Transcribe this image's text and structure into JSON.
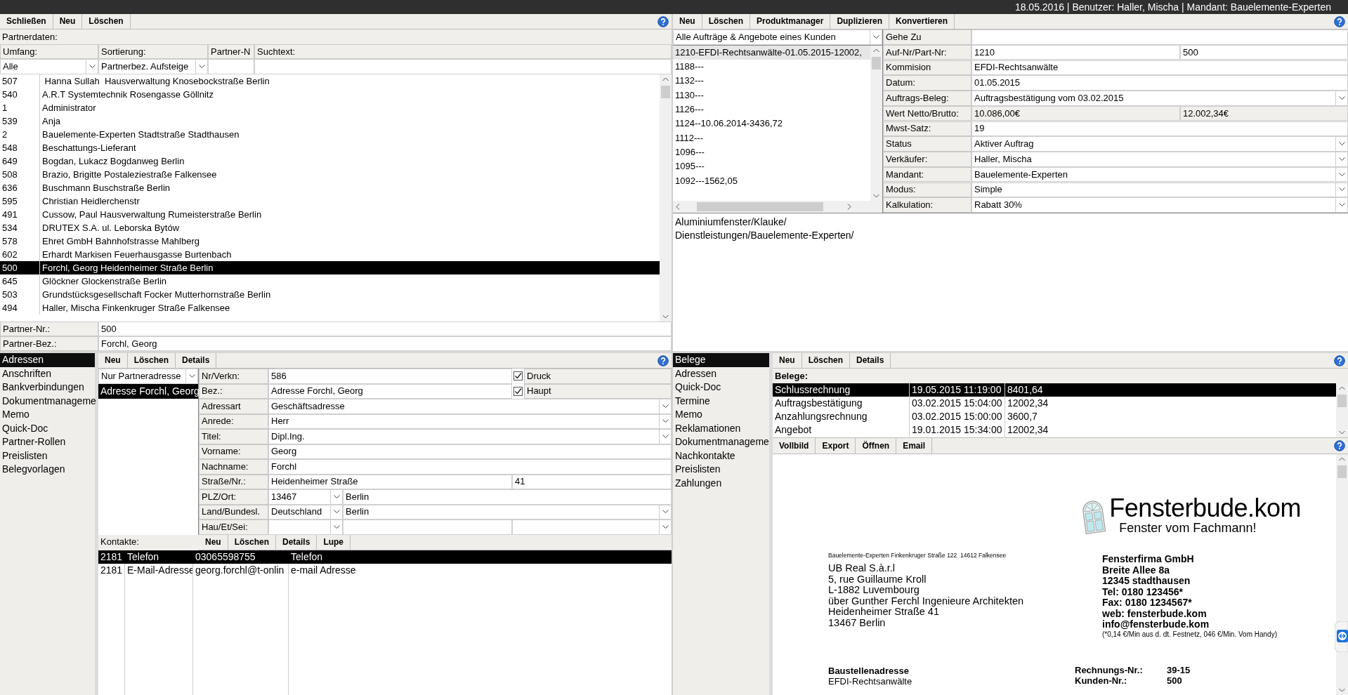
{
  "header": {
    "status": "18.05.2016 | Benutzer: Haller, Mischa | Mandant: Bauelemente-Experten"
  },
  "partners": {
    "toolbar": [
      "Schließen",
      "Neu",
      "Löschen"
    ],
    "title": "Partnerdaten:",
    "filters": [
      {
        "label": "Umfang:",
        "kind": "combo",
        "value": "Alle"
      },
      {
        "label": "Sortierung:",
        "kind": "combo",
        "value": "Partnerbez. Aufsteige"
      },
      {
        "label": "Partner-N",
        "kind": "text"
      },
      {
        "label": "Suchtext:",
        "kind": "text"
      }
    ],
    "rows": [
      {
        "id": "507",
        "name": " Hanna Sullah  Hausverwaltung Knosebockstraße Berlin",
        "selected": false
      },
      {
        "id": "540",
        "name": "A.R.T Systemtechnik Rosengasse Göllnitz",
        "selected": false
      },
      {
        "id": "1",
        "name": "Administrator",
        "selected": false
      },
      {
        "id": "539",
        "name": "Anja",
        "selected": false
      },
      {
        "id": "2",
        "name": "Bauelemente-Experten Stadtstraße Stadthausen",
        "selected": false
      },
      {
        "id": "548",
        "name": "Beschattungs-Lieferant",
        "selected": false
      },
      {
        "id": "649",
        "name": "Bogdan, Lukacz Bogdanweg Berlin",
        "selected": false
      },
      {
        "id": "508",
        "name": "Brazio, Brigitte Postaleziestraße Falkensee",
        "selected": false
      },
      {
        "id": "636",
        "name": "Buschmann Buschstraße Berlin",
        "selected": false
      },
      {
        "id": "595",
        "name": "Christian Heidlerchenstr",
        "selected": false
      },
      {
        "id": "491",
        "name": "Cussow, Paul Hausverwaltung Rumeisterstraße Berlin",
        "selected": false
      },
      {
        "id": "534",
        "name": "DRUTEX S.A. ul. Leborska Bytów",
        "selected": false
      },
      {
        "id": "578",
        "name": "Ehret GmbH Bahnhofstrasse Mahlberg",
        "selected": false
      },
      {
        "id": "602",
        "name": "Erhardt Markisen Feuerhausgasse Burtenbach",
        "selected": false
      },
      {
        "id": "500",
        "name": "Forchl, Georg Heidenheimer Straße Berlin",
        "selected": true
      },
      {
        "id": "645",
        "name": "Glöckner Glockenstraße Berlin",
        "selected": false
      },
      {
        "id": "503",
        "name": "Grundstücksgesellschaft Focker Mutterhornstraße Berlin",
        "selected": false
      },
      {
        "id": "494",
        "name": "Haller, Mischa Finkenkruger Straße Falkensee",
        "selected": false
      }
    ],
    "fields": [
      {
        "label": "Partner-Nr.:",
        "value": "500"
      },
      {
        "label": "Partner-Bez.:",
        "value": "Forchl, Georg"
      }
    ]
  },
  "orders": {
    "toolbar": [
      "Neu",
      "Löschen",
      "Produktmanager",
      "Duplizieren",
      "Konvertieren"
    ],
    "filter": "Alle Aufträge & Angebote eines Kunden",
    "list": [
      {
        "text": "1210-EFDI-Rechtsanwälte-01.05.2015-12002,",
        "selected": true
      },
      {
        "text": "1188---",
        "selected": false
      },
      {
        "text": "1132---",
        "selected": false
      },
      {
        "text": "1130---",
        "selected": false
      },
      {
        "text": "1126---",
        "selected": false
      },
      {
        "text": "1124--10.06.2014-3436,72",
        "selected": false
      },
      {
        "text": "1112---",
        "selected": false
      },
      {
        "text": "1096---",
        "selected": false
      },
      {
        "text": "1095---",
        "selected": false
      },
      {
        "text": "1092---1562,05",
        "selected": false
      }
    ],
    "form": [
      {
        "label": "Gehe Zu",
        "cells": [
          {
            "kind": "text"
          }
        ]
      },
      {
        "label": "Auf-Nr/Part-Nr:",
        "cells": [
          {
            "kind": "text",
            "value": "1210"
          },
          {
            "kind": "text",
            "value": "500"
          }
        ]
      },
      {
        "label": "Kommision",
        "cells": [
          {
            "kind": "text",
            "value": "EFDI-Rechtsanwälte"
          }
        ]
      },
      {
        "label": "Datum:",
        "cells": [
          {
            "kind": "text",
            "value": "01.05.2015"
          }
        ]
      },
      {
        "label": "Auftrags-Beleg:",
        "cells": [
          {
            "kind": "combo",
            "value": "Auftragsbestätigung vom 03.02.2015"
          }
        ]
      },
      {
        "label": "Wert Netto/Brutto:",
        "cells": [
          {
            "kind": "readonly",
            "value": "10.086,00€"
          },
          {
            "kind": "readonly",
            "value": "12.002,34€"
          }
        ]
      },
      {
        "label": "Mwst-Satz:",
        "cells": [
          {
            "kind": "text",
            "value": "19"
          }
        ]
      },
      {
        "label": "Status",
        "cells": [
          {
            "kind": "combo",
            "value": "Aktiver Auftrag"
          }
        ]
      },
      {
        "label": "Verkäufer:",
        "cells": [
          {
            "kind": "combo",
            "value": "Haller, Mischa"
          }
        ]
      },
      {
        "label": "Mandant:",
        "cells": [
          {
            "kind": "combo",
            "value": "Bauelemente-Experten"
          }
        ]
      },
      {
        "label": "Modus:",
        "cells": [
          {
            "kind": "combo",
            "value": "Simple"
          }
        ]
      },
      {
        "label": "Kalkulation:",
        "cells": [
          {
            "kind": "combo",
            "value": "Rabatt 30%"
          }
        ]
      }
    ],
    "categories": [
      "Aluminiumfenster/Klauke/",
      "Dienstleistungen/Bauelemente-Experten/"
    ]
  },
  "partner_detail": {
    "tabs": [
      {
        "label": "Adressen",
        "selected": true
      },
      {
        "label": "Anschriften",
        "selected": false
      },
      {
        "label": "Bankverbindungen",
        "selected": false
      },
      {
        "label": "Dokumentmanageme",
        "selected": false
      },
      {
        "label": "Memo",
        "selected": false
      },
      {
        "label": "Quick-Doc",
        "selected": false
      },
      {
        "label": "Partner-Rollen",
        "selected": false
      },
      {
        "label": "Preislisten",
        "selected": false
      },
      {
        "label": "Belegvorlagen",
        "selected": false
      }
    ],
    "toolbar": [
      "Neu",
      "Löschen",
      "Details"
    ],
    "address_filter": "Nur Partneradresse",
    "addresses": [
      {
        "text": "Adresse Forchl, Georg",
        "selected": true
      }
    ],
    "form": [
      {
        "label": "Nr/Verkn:",
        "cells": [
          {
            "kind": "text",
            "value": "586"
          },
          {
            "kind": "check",
            "checked": true,
            "label": "Druck"
          }
        ]
      },
      {
        "label": "Bez.:",
        "cells": [
          {
            "kind": "text",
            "value": "Adresse Forchl, Georg"
          },
          {
            "kind": "check",
            "checked": true,
            "label": "Haupt"
          }
        ]
      },
      {
        "label": "Adressart",
        "cells": [
          {
            "kind": "combo",
            "value": "Geschäftsadresse"
          }
        ]
      },
      {
        "label": "Anrede:",
        "cells": [
          {
            "kind": "combo",
            "value": "Herr"
          }
        ]
      },
      {
        "label": "Titel:",
        "cells": [
          {
            "kind": "combo",
            "value": "Dipl.Ing."
          }
        ]
      },
      {
        "label": "Vorname:",
        "cells": [
          {
            "kind": "text",
            "value": "Georg"
          }
        ]
      },
      {
        "label": "Nachname:",
        "cells": [
          {
            "kind": "text",
            "value": "Forchl"
          }
        ]
      },
      {
        "label": "Straße/Nr.:",
        "cells": [
          {
            "kind": "text",
            "value": "Heidenheimer Straße"
          },
          {
            "kind": "text",
            "value": "41"
          }
        ]
      },
      {
        "label": "PLZ/Ort:",
        "cells": [
          {
            "kind": "combo",
            "value": "13467"
          },
          {
            "kind": "text",
            "value": "Berlin"
          }
        ]
      },
      {
        "label": "Land/Bundesl.",
        "cells": [
          {
            "kind": "combo",
            "value": "Deutschland"
          },
          {
            "kind": "combo",
            "value": "Berlin"
          }
        ]
      },
      {
        "label": "Hau/Et/Sei:",
        "cells": [
          {
            "kind": "combo"
          },
          {
            "kind": "text"
          },
          {
            "kind": "combo"
          }
        ]
      }
    ],
    "contacts": {
      "label": "Kontakte:",
      "toolbar": [
        "Neu",
        "Löschen",
        "Details",
        "Lupe"
      ],
      "rows": [
        {
          "cells": [
            "2181",
            "Telefon",
            "03065598755",
            "Telefon"
          ],
          "selected": true
        },
        {
          "cells": [
            "2181",
            "E-Mail-Adresse",
            "georg.forchl@t-onlin",
            "e-mail Adresse"
          ],
          "selected": false
        }
      ]
    }
  },
  "documents": {
    "tabs": [
      {
        "label": "Belege",
        "selected": true
      },
      {
        "label": "Adressen",
        "selected": false
      },
      {
        "label": "Quick-Doc",
        "selected": false
      },
      {
        "label": "Termine",
        "selected": false
      },
      {
        "label": "Memo",
        "selected": false
      },
      {
        "label": "Reklamationen",
        "selected": false
      },
      {
        "label": "Dokumentmanageme",
        "selected": false
      },
      {
        "label": "Nachkontakte",
        "selected": false
      },
      {
        "label": "Preislisten",
        "selected": false
      },
      {
        "label": "Zahlungen",
        "selected": false
      }
    ],
    "toolbar": [
      "Neu",
      "Löschen",
      "Details"
    ],
    "label": "Belege:",
    "rows": [
      {
        "cells": [
          "Schlussrechnung",
          "19.05.2015 11:19:00",
          "8401,64"
        ],
        "selected": true
      },
      {
        "cells": [
          "Auftragsbestätigung",
          "03.02.2015 15:04:00",
          "12002,34"
        ],
        "selected": false
      },
      {
        "cells": [
          "Anzahlungsrechnung",
          "03.02.2015 15:00:00",
          "3600,7"
        ],
        "selected": false
      },
      {
        "cells": [
          "Angebot",
          "19.01.2015 15:34:00",
          "12002,34"
        ],
        "selected": false
      }
    ],
    "preview_toolbar": [
      "Vollbild",
      "Export",
      "Öffnen",
      "Email"
    ],
    "preview": {
      "logo_title": "Fensterbude.kom",
      "logo_slogan": "Fenster vom Fachmann!",
      "sender": "Bauelemente-Experten Finkenkruger Straße 122  14612 Falkensee",
      "recipient": [
        "UB Real S.à.r.l",
        "5, rue Guillaume Kroll",
        "L-1882 Luvembourg",
        "über Gunther Ferchl Ingenieure Architekten",
        "Heidenheimer Straße 41",
        "13467 Berlin"
      ],
      "company": [
        "Fensterfirma GmbH",
        "Breite Allee 8a",
        "12345 stadthausen",
        "Tel: 0180 123456*",
        "Fax: 0180 1234567*",
        "web: fensterbude.kom",
        "info@fensterbude.kom"
      ],
      "note": "(*0,14 €/Min aus d. dt. Festnetz, 046 €/Min. Vom Handy)",
      "site_label": "Baustellenadresse",
      "site_lines": [
        "EFDI-Rechtsanwälte"
      ],
      "meta": [
        {
          "label": "Rechnungs-Nr.:",
          "value": "39-15"
        },
        {
          "label": "Kunden-Nr.:",
          "value": "500"
        }
      ]
    }
  }
}
